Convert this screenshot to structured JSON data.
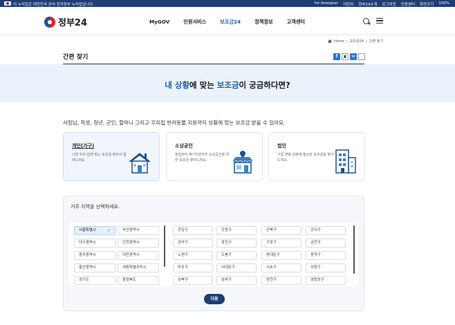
{
  "gov_bar": {
    "notice": "이 누리집은 대한민국 공식 전자정부 누리집입니다.",
    "links": [
      "for foreigner",
      "어린이",
      "정부24소개",
      "로그아웃",
      "인증센터",
      "화면크기",
      "100%"
    ]
  },
  "header": {
    "logo": "정부24",
    "nav": [
      {
        "label": "MyGOV",
        "active": false
      },
      {
        "label": "민원서비스",
        "active": false
      },
      {
        "label": "보조금24",
        "active": true
      },
      {
        "label": "정책정보",
        "active": false
      },
      {
        "label": "고객센터",
        "active": false
      }
    ]
  },
  "breadcrumb": [
    "Home",
    "보조금24",
    "간편 찾기"
  ],
  "page_title": "간편 찾기",
  "banner": {
    "prefix": "내 상황",
    "mid1": "에 맞는 ",
    "highlight": "보조금",
    "suffix": "이 궁금하다면?"
  },
  "intro": "사장님, 학생, 청년, 군인, 할머니 그리고 우리집 반려동물 지원까지 상황에 맞는 보조금 받을 수 있어요.",
  "cards": [
    {
      "title": "개인(가구)",
      "desc": "나와 우리 집에 맞는 보조금 찾아서 알려드려요.",
      "selected": true
    },
    {
      "title": "소상공인",
      "desc": "창업부터 재기지원까지 소상공인을 위한 보조금 찾아드려요.",
      "selected": false
    },
    {
      "title": "법인",
      "desc": "기업 역량 강화에 필요한 보조금을 찾아드려요.",
      "selected": false
    }
  ],
  "region": {
    "question": "거주 지역을 선택하세요.",
    "provinces": [
      "서울특별시",
      "부산광역시",
      "대구광역시",
      "인천광역시",
      "광주광역시",
      "대전광역시",
      "울산광역시",
      "세종특별자치시",
      "경기도",
      "충청북도"
    ],
    "selected_province": "서울특별시",
    "districts": [
      "강남구",
      "강동구",
      "강북구",
      "강서구",
      "관악구",
      "광진구",
      "구로구",
      "금천구",
      "노원구",
      "도봉구",
      "동대문구",
      "동작구",
      "마포구",
      "서대문구",
      "서초구",
      "성동구",
      "성북구",
      "송파구",
      "양천구",
      "영등포구"
    ],
    "next_label": "다음"
  }
}
